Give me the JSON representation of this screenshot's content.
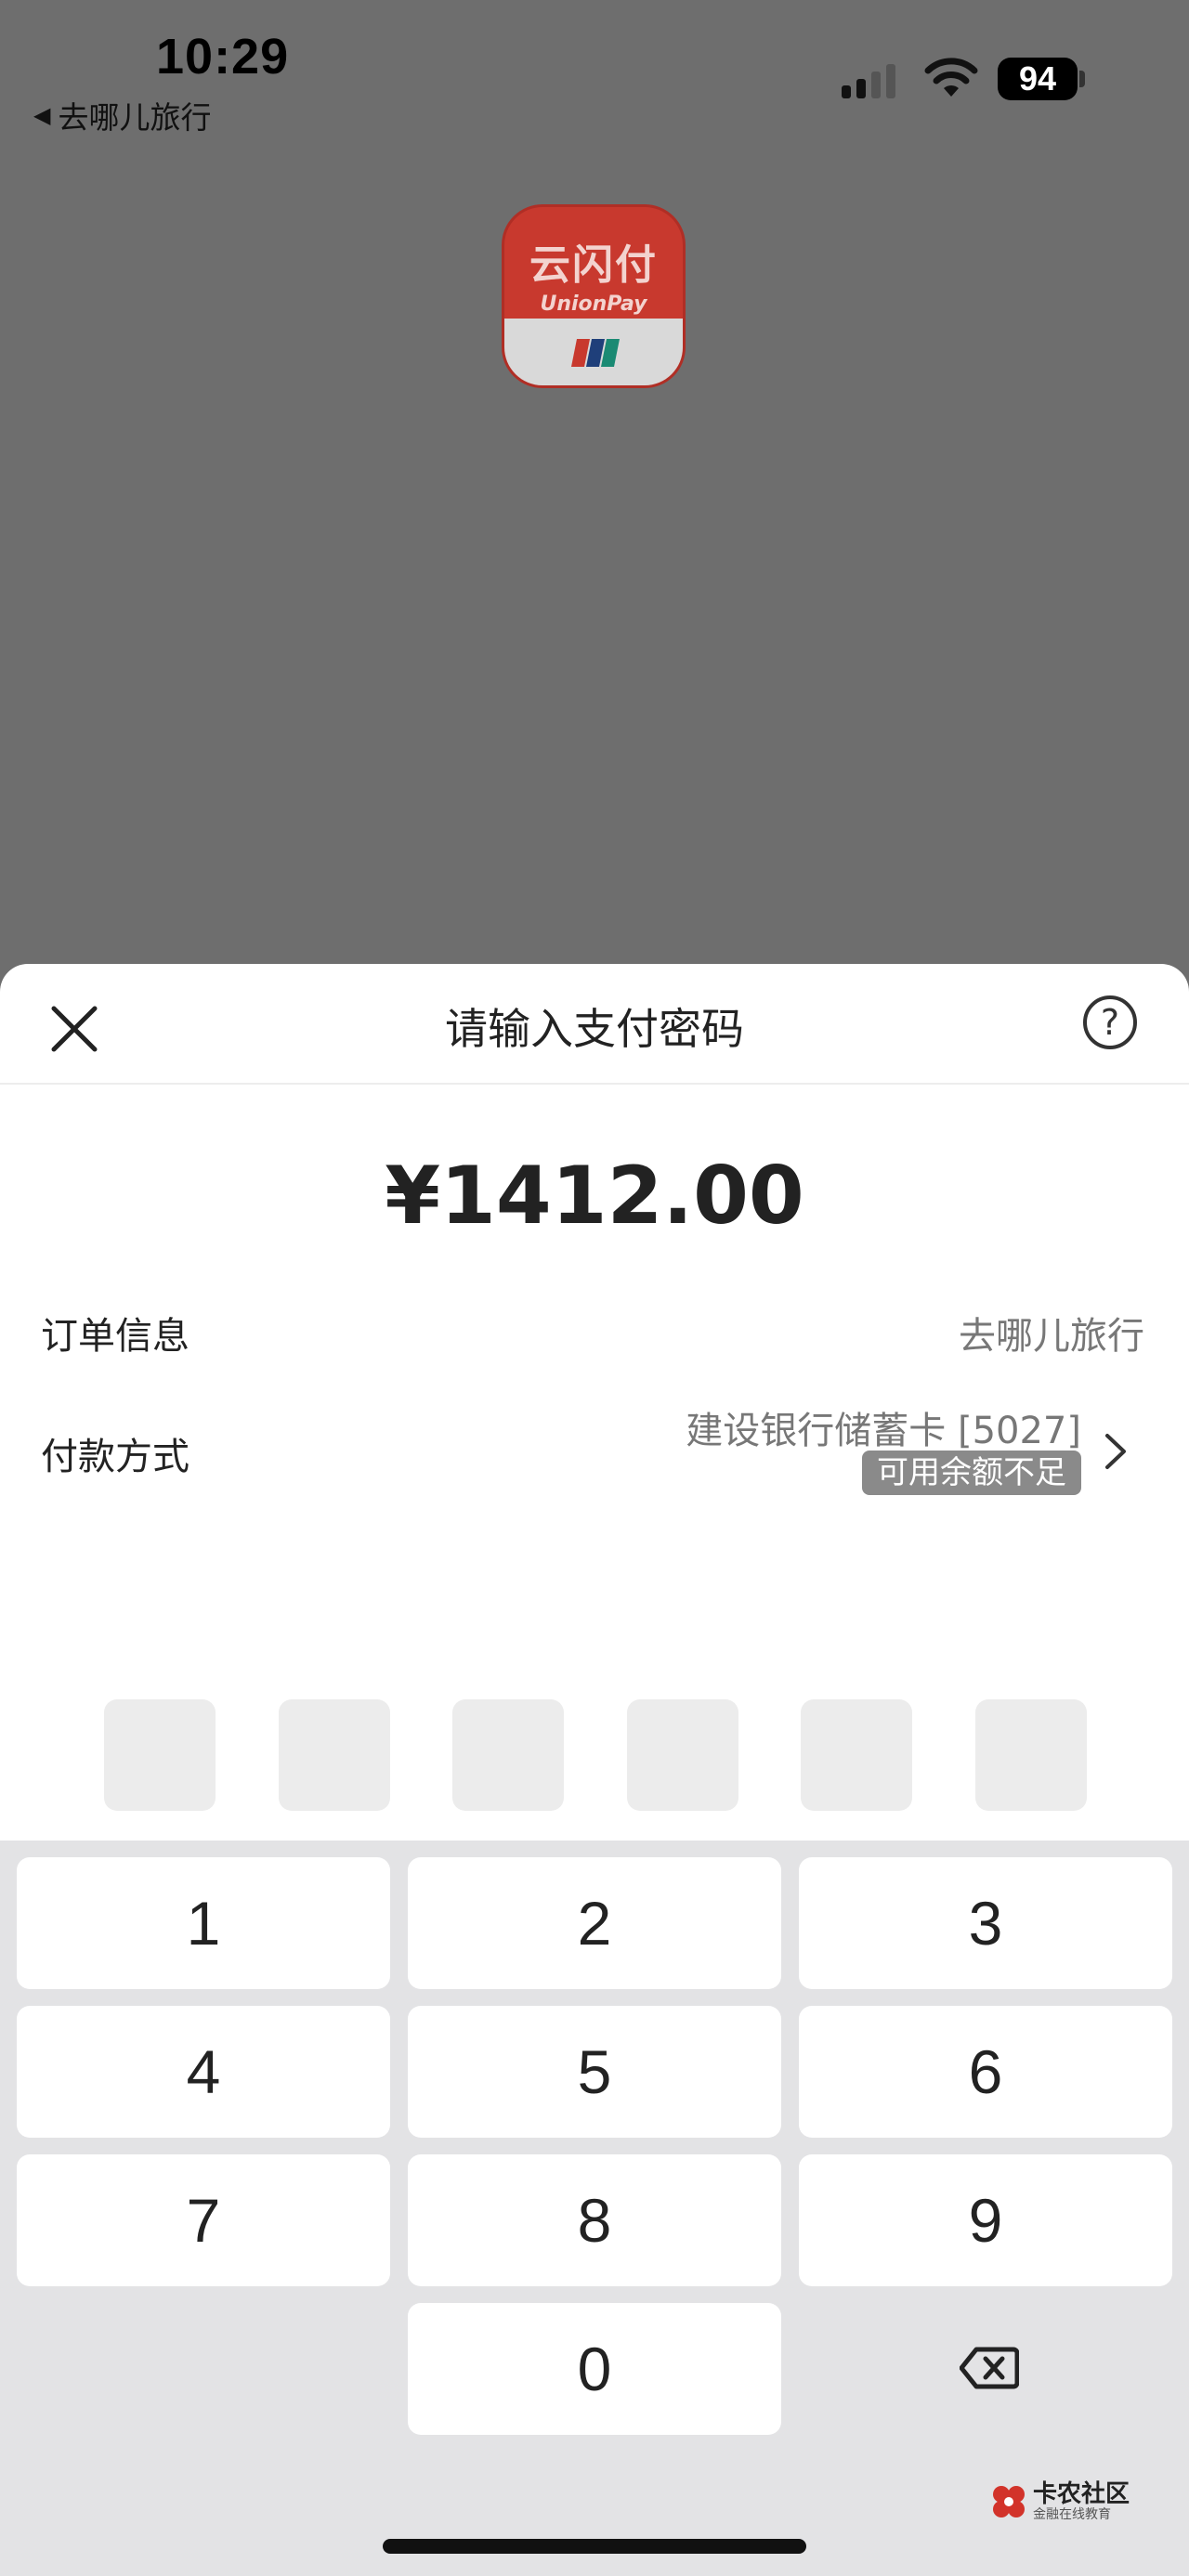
{
  "status_bar": {
    "time": "10:29",
    "back_label": "去哪儿旅行",
    "battery": "94"
  },
  "app_logo": {
    "name_cn": "云闪付",
    "name_en": "UnionPay"
  },
  "sheet": {
    "title": "请输入支付密码",
    "help": "?",
    "amount": "¥1412.00",
    "order_label": "订单信息",
    "order_value": "去哪儿旅行",
    "payment_label": "付款方式",
    "payment_card": "建设银行储蓄卡 [5027]",
    "payment_badge": "可用余额不足"
  },
  "keypad": {
    "keys": [
      "1",
      "2",
      "3",
      "4",
      "5",
      "6",
      "7",
      "8",
      "9",
      "0"
    ]
  },
  "watermark": {
    "main": "卡农社区",
    "sub": "金融在线教育"
  },
  "colors": {
    "overlay": "#6e6e6e",
    "brand_red": "#c8392e",
    "badge_gray": "#8a8a8a",
    "keypad_bg": "#e3e3e5"
  },
  "icons": [
    "back-arrow-icon",
    "signal-icon",
    "wifi-icon",
    "battery-icon",
    "close-icon",
    "help-icon",
    "chevron-right-icon",
    "backspace-icon"
  ]
}
